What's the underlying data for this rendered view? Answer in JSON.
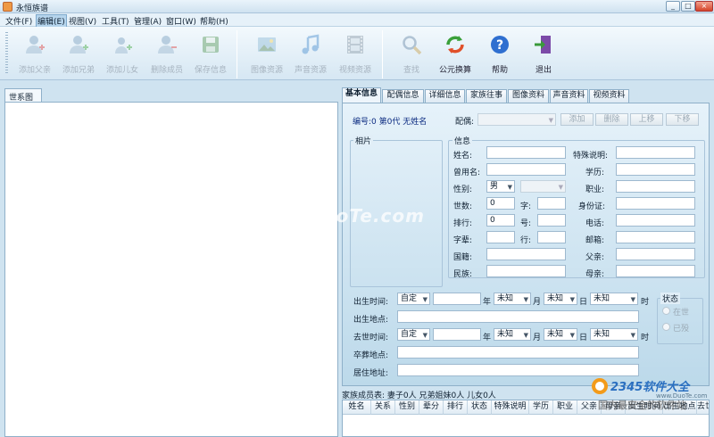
{
  "window": {
    "title": "永恒族谱",
    "buttons": [
      "_",
      "□",
      "×"
    ]
  },
  "menu": [
    "文件(F)",
    "编辑(E)",
    "视图(V)",
    "工具(T)",
    "管理(A)",
    "窗口(W)",
    "帮助(H)"
  ],
  "toolbar": {
    "add_father": "添加父亲",
    "add_sibling": "添加兄弟",
    "add_child": "添加儿女",
    "delete_member": "删除成员",
    "save_info": "保存信息",
    "image_res": "图像资源",
    "audio_res": "声音资源",
    "video_res": "视频资源",
    "search": "查找",
    "calendar_convert": "公元换算",
    "help": "帮助",
    "exit": "退出"
  },
  "tree_tab": "世系图",
  "tabs": [
    "基本信息",
    "配偶信息",
    "详细信息",
    "家族往事",
    "图像资料",
    "声音资料",
    "视频资料"
  ],
  "header": {
    "info": "编号:0 第0代 无姓名",
    "spouse_label": "配偶:",
    "add": "添加",
    "delete": "删除",
    "up": "上移",
    "down": "下移"
  },
  "photo_group": "相片",
  "info_group": "信息",
  "fields": {
    "name": "姓名:",
    "alias": "曾用名:",
    "gender": "性别:",
    "gender_value": "男",
    "generation": "世数:",
    "generation_value": "0",
    "zi": "字:",
    "rank": "排行:",
    "rank_value": "0",
    "hao": "号:",
    "zibei": "字辈:",
    "hang": "行:",
    "nationality": "国籍:",
    "ethnicity": "民族:",
    "special": "特殊说明:",
    "education": "学历:",
    "occupation": "职业:",
    "idcard": "身份证:",
    "phone": "电话:",
    "email": "邮箱:",
    "father": "父亲:",
    "mother": "母亲:"
  },
  "dates": {
    "birth_time": "出生时间:",
    "birth_place": "出生地点:",
    "death_time": "去世时间:",
    "burial_place": "卒葬地点:",
    "residence": "居住地址:",
    "custom": "自定",
    "unknown": "未知",
    "year": "年",
    "month": "月",
    "day": "日",
    "hour": "时"
  },
  "status": {
    "title": "状态",
    "alive": "在世",
    "deceased": "已殁"
  },
  "members": {
    "summary": "家族成员表: 妻子0人 兄弟姐妹0人 儿女0人",
    "columns": [
      "姓名",
      "关系",
      "性别",
      "辈分",
      "排行",
      "状态",
      "特殊说明",
      "学历",
      "职业",
      "父亲",
      "母亲",
      "出生时间",
      "出生地点",
      "去世"
    ]
  },
  "watermark": "www.DuoTe.com",
  "logo": {
    "brand": "2345软件大全",
    "url": "www.DuoTe.com",
    "slogan": "国内最安全的软件站"
  },
  "colors": {
    "accent": "#0a2a80",
    "panel": "#cfe3f0",
    "border": "#8fb0c9"
  }
}
